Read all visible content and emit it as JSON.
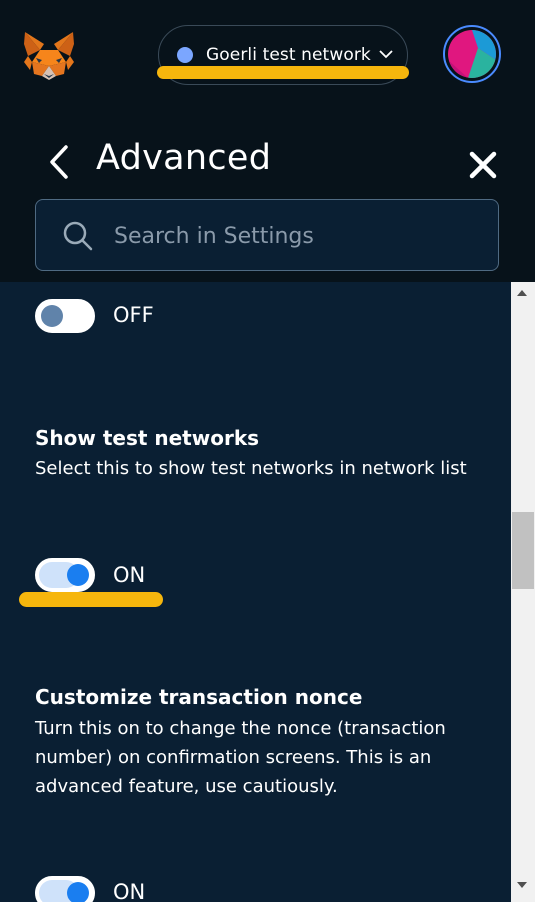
{
  "header": {
    "network": {
      "label": "Goerli test network",
      "dot_color": "#7ba6ff"
    },
    "page_title": "Advanced"
  },
  "search": {
    "placeholder": "Search in Settings"
  },
  "settings": {
    "first_toggle": {
      "state": "OFF"
    },
    "show_test_networks": {
      "title": "Show test networks",
      "description": "Select this to show test networks in network list",
      "state": "ON"
    },
    "customize_nonce": {
      "title": "Customize transaction nonce",
      "description": "Turn this on to change the nonce (transaction number) on confirmation screens. This is an advanced feature, use cautiously.",
      "state": "ON"
    }
  },
  "colors": {
    "background": "#0a1f33",
    "header_bg": "#07121a",
    "highlight": "#f6b60d",
    "toggle_on": "#1a7ef0"
  },
  "icons": {
    "logo": "metamask-fox-icon",
    "back": "chevron-left-icon",
    "close": "close-icon",
    "search": "search-icon",
    "dropdown": "chevron-down-icon"
  }
}
